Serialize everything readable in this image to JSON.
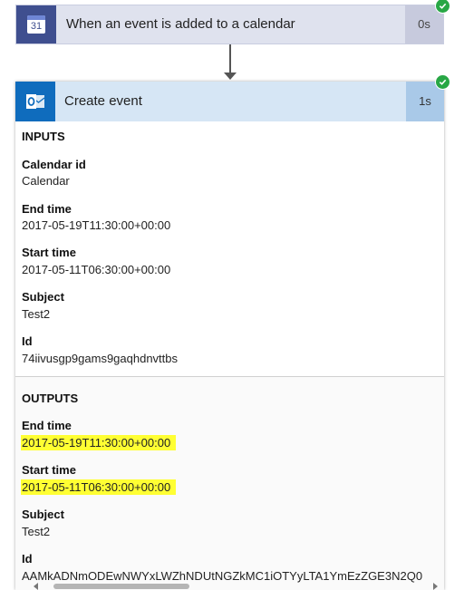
{
  "trigger": {
    "title": "When an event is added to a calendar",
    "duration": "0s",
    "icon": "calendar-icon",
    "icon_text": "31",
    "status": "succeeded"
  },
  "action": {
    "title": "Create event",
    "duration": "1s",
    "icon": "outlook-icon",
    "status": "succeeded",
    "inputs": {
      "heading": "INPUTS",
      "fields": [
        {
          "label": "Calendar id",
          "value": "Calendar"
        },
        {
          "label": "End time",
          "value": "2017-05-19T11:30:00+00:00"
        },
        {
          "label": "Start time",
          "value": "2017-05-11T06:30:00+00:00"
        },
        {
          "label": "Subject",
          "value": "Test2"
        },
        {
          "label": "Id",
          "value": "74iivusgp9gams9gaqhdnvttbs"
        }
      ]
    },
    "outputs": {
      "heading": "OUTPUTS",
      "fields": [
        {
          "label": "End time",
          "value": "2017-05-19T11:30:00+00:00",
          "highlighted": true
        },
        {
          "label": "Start time",
          "value": "2017-05-11T06:30:00+00:00",
          "highlighted": true
        },
        {
          "label": "Subject",
          "value": "Test2"
        },
        {
          "label": "Id",
          "value": "AAMkADNmODEwNWYxLWZhNDUtNGZkMC1iOTYyLTA1YmEzZGE3N2Q0"
        }
      ]
    }
  },
  "colors": {
    "trigger_icon_bg": "#3f4f8f",
    "trigger_card_bg": "#dfe2ee",
    "action_icon_bg": "#0f6cbd",
    "action_header_bg": "#d6e6f5",
    "success": "#28a745",
    "highlight": "#ffff33"
  }
}
